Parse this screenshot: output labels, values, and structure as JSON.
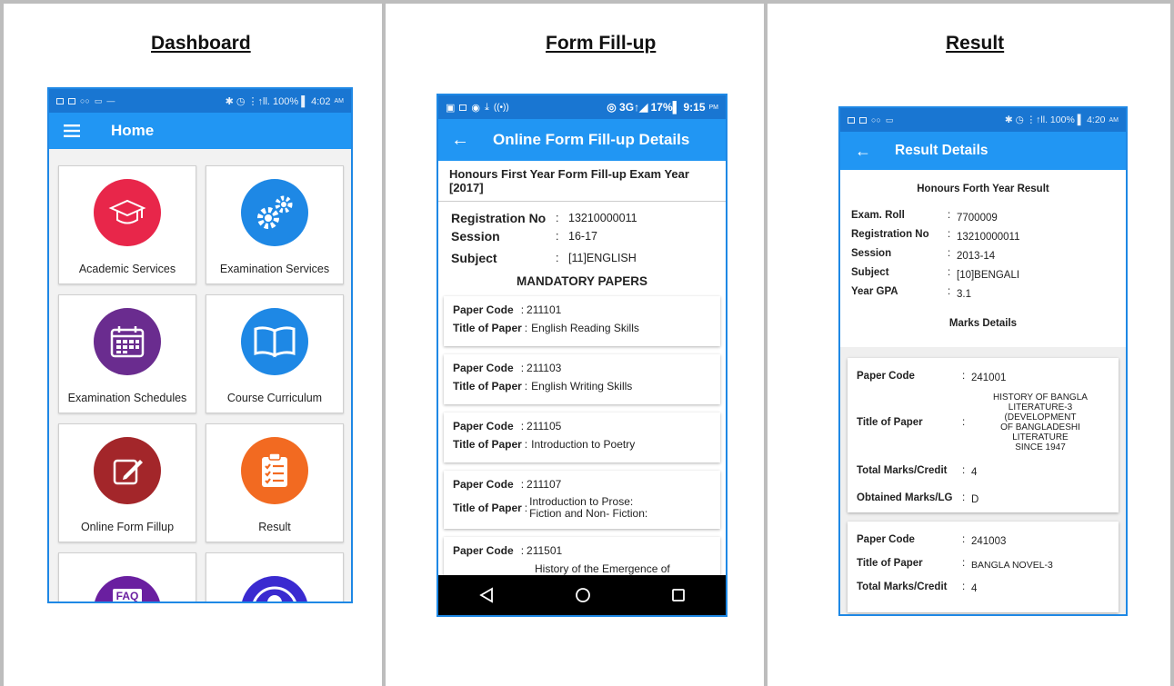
{
  "panels": {
    "dashboard": {
      "title": "Dashboard"
    },
    "form": {
      "title": "Form Fill-up"
    },
    "result": {
      "title": "Result"
    }
  },
  "dashboard": {
    "status": {
      "right": "✱ ◷ ⋮↑ll. 100% ▌ 4:02",
      "ampm": "AM"
    },
    "appbar_title": "Home",
    "tiles": [
      {
        "label": "Academic Services",
        "icon": "graduation-cap-icon",
        "color": "#e8264a"
      },
      {
        "label": "Examination Services",
        "icon": "gears-icon",
        "color": "#1e88e5"
      },
      {
        "label": "Examination Schedules",
        "icon": "calendar-icon",
        "color": "#6a2c8f"
      },
      {
        "label": "Course Curriculum",
        "icon": "book-icon",
        "color": "#1e88e5"
      },
      {
        "label": "Online Form Fillup",
        "icon": "edit-icon",
        "color": "#a3262a"
      },
      {
        "label": "Result",
        "icon": "clipboard-checklist-icon",
        "color": "#f26a21"
      },
      {
        "label": "FAQ",
        "icon": "faq-icon",
        "color": "#6a1fa0"
      },
      {
        "label": "",
        "icon": "user-profile-icon",
        "color": "#3a2ad0"
      }
    ]
  },
  "form": {
    "status": {
      "right": "◎ 3G↑◢ 17%▌ 9:15",
      "ampm": "PM"
    },
    "appbar_title": "Online Form Fill-up Details",
    "header": "Honours First Year Form Fill-up Exam Year [2017]",
    "info": [
      {
        "key": "Registration No",
        "value": "13210000011"
      },
      {
        "key": "Session",
        "value": "16-17"
      },
      {
        "key": "Subject",
        "value": "[11]ENGLISH"
      }
    ],
    "mandatory_heading": "MANDATORY PAPERS",
    "paper_code_label": "Paper Code",
    "title_label": "Title of Paper",
    "papers": [
      {
        "code": "211101",
        "title": "English Reading Skills"
      },
      {
        "code": "211103",
        "title": "English Writing Skills"
      },
      {
        "code": "211105",
        "title": "Introduction to Poetry"
      },
      {
        "code": "211107",
        "title_line1": "Introduction to Prose:",
        "title_line2": "Fiction and Non- Fiction:"
      },
      {
        "code": "211501",
        "title": "History of the Emergence of"
      }
    ]
  },
  "result": {
    "status": {
      "right": "✱ ◷ ⋮↑ll. 100% ▌ 4:20",
      "ampm": "AM"
    },
    "appbar_title": "Result Details",
    "header": "Honours Forth Year Result",
    "info": [
      {
        "key": "Exam. Roll",
        "value": "7700009"
      },
      {
        "key": "Registration No",
        "value": "13210000011"
      },
      {
        "key": "Session",
        "value": "2013-14"
      },
      {
        "key": "Subject",
        "value": "[10]BENGALI"
      },
      {
        "key": "Year GPA",
        "value": "3.1"
      }
    ],
    "marks_heading": "Marks Details",
    "labels": {
      "paper_code": "Paper Code",
      "title": "Title of Paper",
      "total": "Total Marks/Credit",
      "obtained": "Obtained Marks/LG"
    },
    "cards": [
      {
        "code": "241001",
        "title_lines": [
          "HISTORY OF BANGLA",
          "LITERATURE-3 (DEVELOPMENT",
          "OF BANGLADESHI LITERATURE",
          "SINCE 1947"
        ],
        "total": "4",
        "obtained": "D"
      },
      {
        "code": "241003",
        "title": "BANGLA NOVEL-3",
        "total": "4"
      }
    ]
  }
}
